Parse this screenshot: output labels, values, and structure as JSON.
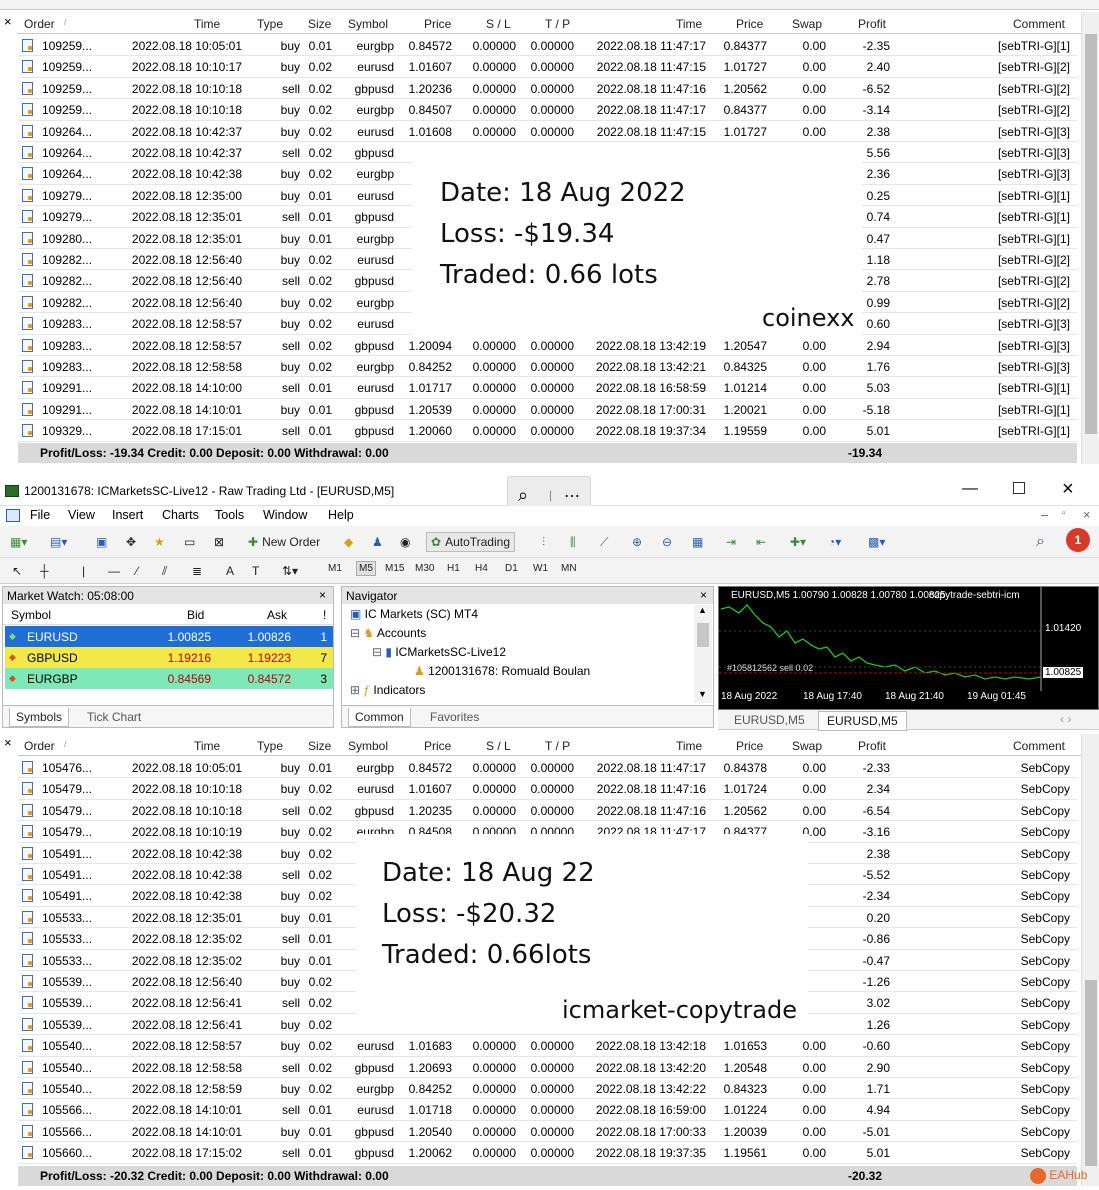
{
  "columns": {
    "order": "Order",
    "time": "Time",
    "type": "Type",
    "size": "Size",
    "symbol": "Symbol",
    "price": "Price",
    "sl": "S / L",
    "tp": "T / P",
    "close_time": "Time",
    "close_price": "Price",
    "swap": "Swap",
    "profit": "Profit",
    "comment": "Comment"
  },
  "top_table": {
    "rows": [
      [
        "109259...",
        "2022.08.18 10:05:01",
        "buy",
        "0.01",
        "eurgbp",
        "0.84572",
        "0.00000",
        "0.00000",
        "2022.08.18 11:47:17",
        "0.84377",
        "0.00",
        "-2.35",
        "[sebTRI-G][1]"
      ],
      [
        "109259...",
        "2022.08.18 10:10:17",
        "buy",
        "0.02",
        "eurusd",
        "1.01607",
        "0.00000",
        "0.00000",
        "2022.08.18 11:47:15",
        "1.01727",
        "0.00",
        "2.40",
        "[sebTRI-G][2]"
      ],
      [
        "109259...",
        "2022.08.18 10:10:18",
        "sell",
        "0.02",
        "gbpusd",
        "1.20236",
        "0.00000",
        "0.00000",
        "2022.08.18 11:47:16",
        "1.20562",
        "0.00",
        "-6.52",
        "[sebTRI-G][2]"
      ],
      [
        "109259...",
        "2022.08.18 10:10:18",
        "buy",
        "0.02",
        "eurgbp",
        "0.84507",
        "0.00000",
        "0.00000",
        "2022.08.18 11:47:17",
        "0.84377",
        "0.00",
        "-3.14",
        "[sebTRI-G][2]"
      ],
      [
        "109264...",
        "2022.08.18 10:42:37",
        "buy",
        "0.02",
        "eurusd",
        "1.01608",
        "0.00000",
        "0.00000",
        "2022.08.18 11:47:15",
        "1.01727",
        "0.00",
        "2.38",
        "[sebTRI-G][3]"
      ],
      [
        "109264...",
        "2022.08.18 10:42:37",
        "sell",
        "0.02",
        "gbpusd",
        "1",
        "",
        "",
        "",
        "",
        "",
        "5.56",
        "[sebTRI-G][3]"
      ],
      [
        "109264...",
        "2022.08.18 10:42:38",
        "buy",
        "0.02",
        "eurgbp",
        "(",
        "",
        "",
        "",
        "",
        "",
        "2.36",
        "[sebTRI-G][3]"
      ],
      [
        "109279...",
        "2022.08.18 12:35:00",
        "buy",
        "0.01",
        "eurusd",
        "1",
        "",
        "",
        "",
        "",
        "",
        "0.25",
        "[sebTRI-G][1]"
      ],
      [
        "109279...",
        "2022.08.18 12:35:01",
        "sell",
        "0.01",
        "gbpusd",
        "1",
        "",
        "",
        "",
        "",
        "",
        "0.74",
        "[sebTRI-G][1]"
      ],
      [
        "109280...",
        "2022.08.18 12:35:01",
        "buy",
        "0.01",
        "eurgbp",
        "(",
        "",
        "",
        "",
        "",
        "",
        "0.47",
        "[sebTRI-G][1]"
      ],
      [
        "109282...",
        "2022.08.18 12:56:40",
        "buy",
        "0.02",
        "eurusd",
        "1",
        "",
        "",
        "",
        "",
        "",
        "1.18",
        "[sebTRI-G][2]"
      ],
      [
        "109282...",
        "2022.08.18 12:56:40",
        "sell",
        "0.02",
        "gbpusd",
        "1",
        "",
        "",
        "",
        "",
        "",
        "2.78",
        "[sebTRI-G][2]"
      ],
      [
        "109282...",
        "2022.08.18 12:56:40",
        "buy",
        "0.02",
        "eurgbp",
        "(",
        "",
        "",
        "",
        "",
        "",
        "0.99",
        "[sebTRI-G][2]"
      ],
      [
        "109283...",
        "2022.08.18 12:58:57",
        "buy",
        "0.02",
        "eurusd",
        "1",
        "",
        "",
        "",
        "",
        "",
        "0.60",
        "[sebTRI-G][3]"
      ],
      [
        "109283...",
        "2022.08.18 12:58:57",
        "sell",
        "0.02",
        "gbpusd",
        "1.20094",
        "0.00000",
        "0.00000",
        "2022.08.18 13:42:19",
        "1.20547",
        "0.00",
        "2.94",
        "[sebTRI-G][3]"
      ],
      [
        "109283...",
        "2022.08.18 12:58:58",
        "buy",
        "0.02",
        "eurgbp",
        "0.84252",
        "0.00000",
        "0.00000",
        "2022.08.18 13:42:21",
        "0.84325",
        "0.00",
        "1.76",
        "[sebTRI-G][3]"
      ],
      [
        "109291...",
        "2022.08.18 14:10:00",
        "sell",
        "0.01",
        "eurusd",
        "1.01717",
        "0.00000",
        "0.00000",
        "2022.08.18 16:58:59",
        "1.01214",
        "0.00",
        "5.03",
        "[sebTRI-G][1]"
      ],
      [
        "109291...",
        "2022.08.18 14:10:01",
        "buy",
        "0.01",
        "gbpusd",
        "1.20539",
        "0.00000",
        "0.00000",
        "2022.08.18 17:00:31",
        "1.20021",
        "0.00",
        "-5.18",
        "[sebTRI-G][1]"
      ],
      [
        "109329...",
        "2022.08.18 17:15:01",
        "sell",
        "0.01",
        "gbpusd",
        "1.20060",
        "0.00000",
        "0.00000",
        "2022.08.18 19:37:34",
        "1.19559",
        "0.00",
        "5.01",
        "[sebTRI-G][1]"
      ]
    ],
    "summary": "Profit/Loss: -19.34  Credit: 0.00  Deposit: 0.00  Withdrawal: 0.00",
    "summary_profit": "-19.34",
    "overlay": {
      "line1": "Date: 18 Aug 2022",
      "line2": "Loss: -$19.34",
      "line3": "Traded: 0.66 lots",
      "brand": "coinexx"
    }
  },
  "window": {
    "title": "1200131678: ICMarketsSC-Live12 - Raw Trading Ltd - [EURUSD,M5]",
    "menu": [
      "File",
      "View",
      "Insert",
      "Charts",
      "Tools",
      "Window",
      "Help"
    ],
    "new_order": "New Order",
    "autotrading": "AutoTrading",
    "timeframes": [
      "M1",
      "M5",
      "M15",
      "M30",
      "H1",
      "H4",
      "D1",
      "W1",
      "MN"
    ],
    "chart_tabs": [
      "EURUSD,M5",
      "EURUSD,M5"
    ]
  },
  "market_watch": {
    "title": "Market Watch: 05:08:00",
    "headers": [
      "Symbol",
      "Bid",
      "Ask",
      "!"
    ],
    "rows": [
      {
        "symbol": "EURUSD",
        "bid": "1.00825",
        "ask": "1.00826",
        "spread": "1",
        "bg": "#1f6fd6",
        "fg": "#ffffff"
      },
      {
        "symbol": "GBPUSD",
        "bid": "1.19216",
        "ask": "1.19223",
        "spread": "7",
        "bg": "#f3e84a",
        "fg": "#c00000"
      },
      {
        "symbol": "EURGBP",
        "bid": "0.84569",
        "ask": "0.84572",
        "spread": "3",
        "bg": "#7fe8b8",
        "fg": "#c00000"
      }
    ],
    "tabs": [
      "Symbols",
      "Tick Chart"
    ]
  },
  "navigator": {
    "title": "Navigator",
    "root": "IC Markets (SC) MT4",
    "accounts": "Accounts",
    "server": "ICMarketsSC-Live12",
    "account": "1200131678: Romuald Boulan",
    "indicators": "Indicators",
    "tabs": [
      "Common",
      "Favorites"
    ]
  },
  "mini_chart": {
    "header": "EURUSD,M5  1.00790 1.00828 1.00780 1.00825",
    "ea": "copytrade-sebtri-icm",
    "price_top": "1.01420",
    "price_now": "1.00825",
    "x_labels": [
      "18 Aug 2022",
      "18 Aug 17:40",
      "18 Aug 21:40",
      "19 Aug 01:45"
    ],
    "order_label": "#105812562 sell 0.02"
  },
  "bottom_table": {
    "rows": [
      [
        "105476...",
        "2022.08.18 10:05:01",
        "buy",
        "0.01",
        "eurgbp",
        "0.84572",
        "0.00000",
        "0.00000",
        "2022.08.18 11:47:17",
        "0.84378",
        "0.00",
        "-2.33",
        "SebCopy"
      ],
      [
        "105479...",
        "2022.08.18 10:10:18",
        "buy",
        "0.02",
        "eurusd",
        "1.01607",
        "0.00000",
        "0.00000",
        "2022.08.18 11:47:16",
        "1.01724",
        "0.00",
        "2.34",
        "SebCopy"
      ],
      [
        "105479...",
        "2022.08.18 10:10:18",
        "sell",
        "0.02",
        "gbpusd",
        "1.20235",
        "0.00000",
        "0.00000",
        "2022.08.18 11:47:16",
        "1.20562",
        "0.00",
        "-6.54",
        "SebCopy"
      ],
      [
        "105479...",
        "2022.08.18 10:10:19",
        "buy",
        "0.02",
        "eurgbp",
        "0.84508",
        "0.00000",
        "0.00000",
        "2022.08.18 11:47:17",
        "0.84377",
        "0.00",
        "-3.16",
        "SebCopy"
      ],
      [
        "105491...",
        "2022.08.18 10:42:38",
        "buy",
        "0.02",
        "",
        "",
        "",
        "",
        "",
        "",
        "",
        "2.38",
        "SebCopy"
      ],
      [
        "105491...",
        "2022.08.18 10:42:38",
        "sell",
        "0.02",
        "g",
        "",
        "",
        "",
        "",
        "",
        "",
        "-5.52",
        "SebCopy"
      ],
      [
        "105491...",
        "2022.08.18 10:42:38",
        "buy",
        "0.02",
        "",
        "",
        "",
        "",
        "",
        "",
        "",
        "-2.34",
        "SebCopy"
      ],
      [
        "105533...",
        "2022.08.18 12:35:01",
        "buy",
        "0.01",
        "",
        "",
        "",
        "",
        "",
        "",
        "",
        "0.20",
        "SebCopy"
      ],
      [
        "105533...",
        "2022.08.18 12:35:02",
        "sell",
        "0.01",
        "g",
        "",
        "",
        "",
        "",
        "",
        "",
        "-0.86",
        "SebCopy"
      ],
      [
        "105533...",
        "2022.08.18 12:35:02",
        "buy",
        "0.01",
        "",
        "",
        "",
        "",
        "",
        "",
        "",
        "-0.47",
        "SebCopy"
      ],
      [
        "105539...",
        "2022.08.18 12:56:40",
        "buy",
        "0.02",
        "",
        "",
        "",
        "",
        "",
        "",
        "",
        "-1.26",
        "SebCopy"
      ],
      [
        "105539...",
        "2022.08.18 12:56:41",
        "sell",
        "0.02",
        "g",
        "",
        "",
        "",
        "",
        "",
        "",
        "3.02",
        "SebCopy"
      ],
      [
        "105539...",
        "2022.08.18 12:56:41",
        "buy",
        "0.02",
        "",
        "",
        "",
        "",
        "",
        "",
        "",
        "1.26",
        "SebCopy"
      ],
      [
        "105540...",
        "2022.08.18 12:58:57",
        "buy",
        "0.02",
        "eurusd",
        "1.01683",
        "0.00000",
        "0.00000",
        "2022.08.18 13:42:18",
        "1.01653",
        "0.00",
        "-0.60",
        "SebCopy"
      ],
      [
        "105540...",
        "2022.08.18 12:58:58",
        "sell",
        "0.02",
        "gbpusd",
        "1.20693",
        "0.00000",
        "0.00000",
        "2022.08.18 13:42:20",
        "1.20548",
        "0.00",
        "2.90",
        "SebCopy"
      ],
      [
        "105540...",
        "2022.08.18 12:58:59",
        "buy",
        "0.02",
        "eurgbp",
        "0.84252",
        "0.00000",
        "0.00000",
        "2022.08.18 13:42:22",
        "0.84323",
        "0.00",
        "1.71",
        "SebCopy"
      ],
      [
        "105566...",
        "2022.08.18 14:10:01",
        "sell",
        "0.01",
        "eurusd",
        "1.01718",
        "0.00000",
        "0.00000",
        "2022.08.18 16:59:00",
        "1.01224",
        "0.00",
        "4.94",
        "SebCopy"
      ],
      [
        "105566...",
        "2022.08.18 14:10:01",
        "buy",
        "0.01",
        "gbpusd",
        "1.20540",
        "0.00000",
        "0.00000",
        "2022.08.18 17:00:33",
        "1.20039",
        "0.00",
        "-5.01",
        "SebCopy"
      ],
      [
        "105660...",
        "2022.08.18 17:15:02",
        "sell",
        "0.01",
        "gbpusd",
        "1.20062",
        "0.00000",
        "0.00000",
        "2022.08.18 19:37:35",
        "1.19561",
        "0.00",
        "5.01",
        "SebCopy"
      ]
    ],
    "summary": "Profit/Loss: -20.32  Credit: 0.00  Deposit: 0.00  Withdrawal: 0.00",
    "summary_profit": "-20.32",
    "overlay": {
      "line1": "Date: 18 Aug 22",
      "line2": "Loss: -$20.32",
      "line3": "Traded: 0.66lots",
      "brand": "icmarket-copytrade"
    }
  },
  "watermark": "EAHub",
  "colors": {
    "selected_row": "#1f6fd6",
    "summary_bg": "#d9d9d9",
    "brand_orange": "#e8662a"
  }
}
